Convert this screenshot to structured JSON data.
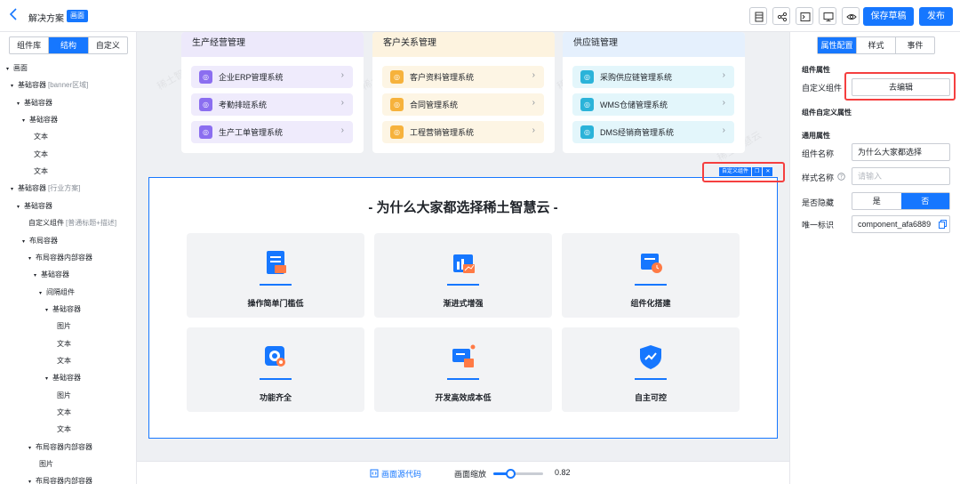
{
  "header": {
    "back_icon": "chevron-left-icon",
    "title": "解决方案",
    "badge": "画面",
    "tools": [
      "layout-icon",
      "share-nodes-icon",
      "terminal-icon",
      "monitor-icon",
      "eye-icon"
    ],
    "save_draft": "保存草稿",
    "publish": "发布"
  },
  "left_panel": {
    "tabs": [
      {
        "label": "组件库",
        "active": false
      },
      {
        "label": "结构",
        "active": true
      },
      {
        "label": "自定义",
        "active": false
      }
    ],
    "tree": [
      {
        "label": "画面",
        "note": "",
        "caret": true
      },
      {
        "label": "基础容器",
        "note": "[banner区域]",
        "caret": true
      },
      {
        "label": "基础容器",
        "note": "",
        "caret": true
      },
      {
        "label": "基础容器",
        "note": "",
        "caret": true
      },
      {
        "label": "文本",
        "note": "",
        "caret": false
      },
      {
        "label": "文本",
        "note": "",
        "caret": false
      },
      {
        "label": "文本",
        "note": "",
        "caret": false
      },
      {
        "label": "基础容器",
        "note": "[行业方案]",
        "caret": true
      },
      {
        "label": "基础容器",
        "note": "",
        "caret": true
      },
      {
        "label": "自定义组件",
        "note": "[普通标题+描述]",
        "caret": false
      },
      {
        "label": "布局容器",
        "note": "",
        "caret": true
      },
      {
        "label": "布局容器内部容器",
        "note": "",
        "caret": true
      },
      {
        "label": "基础容器",
        "note": "",
        "caret": true
      },
      {
        "label": "间隔组件",
        "note": "",
        "caret": true
      },
      {
        "label": "基础容器",
        "note": "",
        "caret": true
      },
      {
        "label": "图片",
        "note": "",
        "caret": false
      },
      {
        "label": "文本",
        "note": "",
        "caret": false
      },
      {
        "label": "文本",
        "note": "",
        "caret": false
      },
      {
        "label": "基础容器",
        "note": "",
        "caret": true
      },
      {
        "label": "图片",
        "note": "",
        "caret": false
      },
      {
        "label": "文本",
        "note": "",
        "caret": false
      },
      {
        "label": "文本",
        "note": "",
        "caret": false
      },
      {
        "label": "布局容器内部容器",
        "note": "",
        "caret": true
      },
      {
        "label": "图片",
        "note": "",
        "caret": false
      },
      {
        "label": "布局容器内部容器",
        "note": "",
        "caret": true
      }
    ]
  },
  "canvas": {
    "cards": [
      {
        "title": "生产经营管理",
        "head_color": "#ede9fb",
        "item_bg": "#efebfc",
        "icon_color": "#8b6ef0",
        "items": [
          "企业ERP管理系统",
          "考勤排班系统",
          "生产工单管理系统"
        ]
      },
      {
        "title": "客户关系管理",
        "head_color": "#fdf3df",
        "item_bg": "#fdf5e4",
        "icon_color": "#f6b23c",
        "items": [
          "客户资料管理系统",
          "合同管理系统",
          "工程营销管理系统"
        ]
      },
      {
        "title": "供应链管理",
        "head_color": "#e5f0fd",
        "item_bg": "#e3f6fb",
        "icon_color": "#2bb3d9",
        "items": [
          "采购供应链管理系统",
          "WMS仓储管理系统",
          "DMS经销商管理系统"
        ]
      }
    ],
    "selection_tag": {
      "label": "自定义组件",
      "copy_icon": "copy-icon",
      "close_icon": "close-icon"
    },
    "section_title": "- 为什么大家都选择稀土智慧云 -",
    "features": [
      {
        "label": "操作简单门槛低",
        "icon": "document-icon"
      },
      {
        "label": "渐进式增强",
        "icon": "chart-growth-icon"
      },
      {
        "label": "组件化搭建",
        "icon": "module-clock-icon"
      },
      {
        "label": "功能齐全",
        "icon": "target-search-icon"
      },
      {
        "label": "开发高效成本低",
        "icon": "message-icon"
      },
      {
        "label": "自主可控",
        "icon": "shield-check-icon"
      }
    ],
    "watermark": "稀土智慧云"
  },
  "bottom_bar": {
    "source_code": "画面源代码",
    "zoom_label": "画面缩放",
    "zoom_value": "0.82"
  },
  "right_panel": {
    "tabs": [
      {
        "label": "属性配置",
        "active": true
      },
      {
        "label": "样式",
        "active": false
      },
      {
        "label": "事件",
        "active": false
      }
    ],
    "section_component": "组件属性",
    "custom_component_label": "自定义组件",
    "edit_button": "去编辑",
    "section_custom_props": "组件自定义属性",
    "section_common": "通用属性",
    "name_label": "组件名称",
    "name_value": "为什么大家都选择",
    "style_label": "样式名称",
    "style_placeholder": "请输入",
    "hidden_label": "是否隐藏",
    "hidden_yes": "是",
    "hidden_no": "否",
    "id_label": "唯一标识",
    "id_value": "component_afa6889"
  },
  "colors": {
    "accent": "#1677ff",
    "highlight": "#f53f3f"
  }
}
